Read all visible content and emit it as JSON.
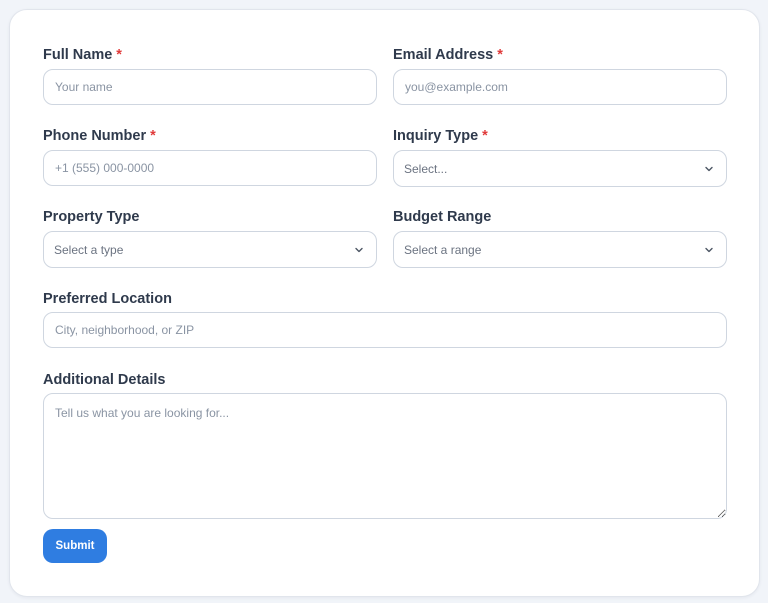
{
  "form": {
    "full_name": {
      "label": "Full Name",
      "required_mark": "*",
      "placeholder": "Your name",
      "value": ""
    },
    "email": {
      "label": "Email Address",
      "required_mark": "*",
      "placeholder": "you@example.com",
      "value": ""
    },
    "phone": {
      "label": "Phone Number",
      "required_mark": "*",
      "placeholder": "+1 (555) 000-0000",
      "value": ""
    },
    "inquiry_type": {
      "label": "Inquiry Type",
      "required_mark": "*",
      "selected": "Select...",
      "icon": "chevron-down-icon"
    },
    "property_type": {
      "label": "Property Type",
      "selected": "Select a type",
      "icon": "chevron-down-icon"
    },
    "budget_range": {
      "label": "Budget Range",
      "selected": "Select a range",
      "icon": "chevron-down-icon"
    },
    "location": {
      "label": "Preferred Location",
      "placeholder": "City, neighborhood, or ZIP",
      "value": ""
    },
    "details": {
      "label": "Additional Details",
      "placeholder": "Tell us what you are looking for...",
      "value": ""
    },
    "submit_label": "Submit"
  },
  "colors": {
    "accent": "#2f7de1",
    "required": "#e03a3a",
    "label": "#2f3a4c",
    "border": "#cfd6e0",
    "background": "#f1f4f9"
  }
}
